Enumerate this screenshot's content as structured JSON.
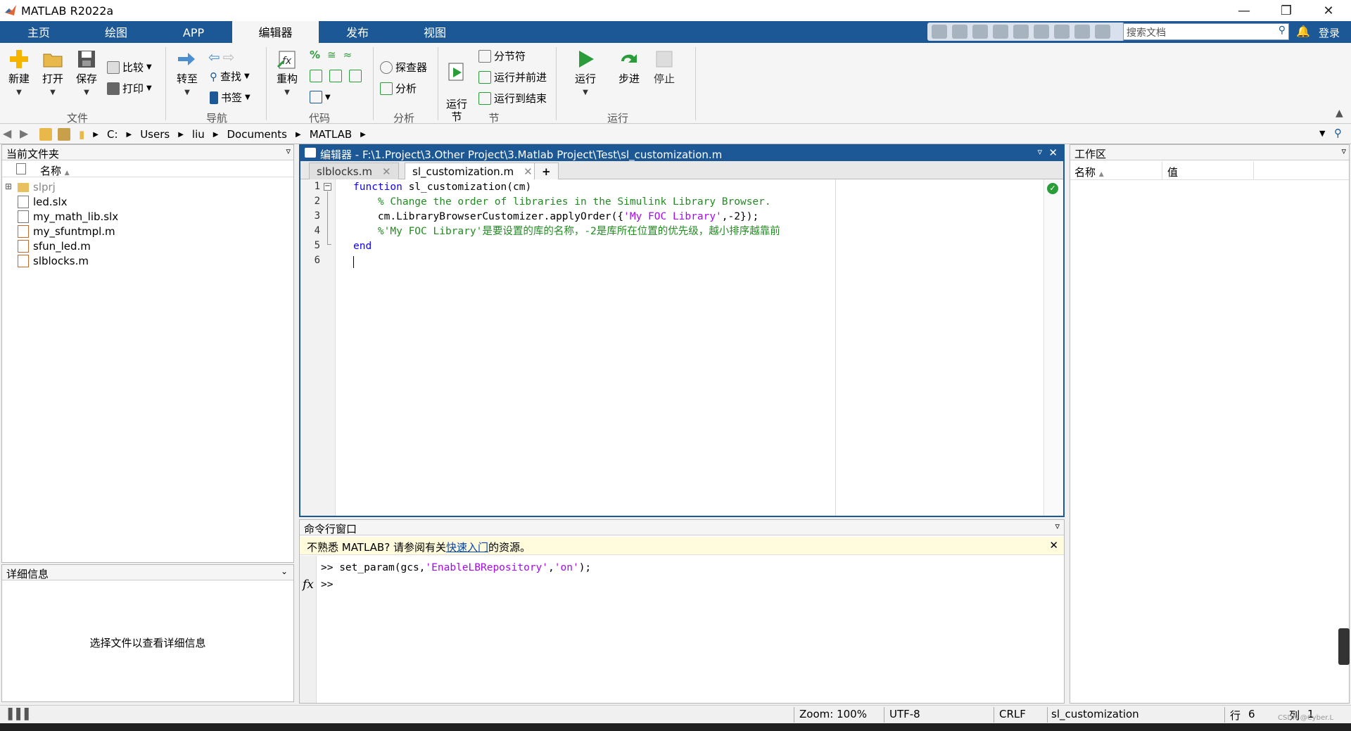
{
  "window": {
    "title": "MATLAB R2022a"
  },
  "tabs": [
    "主页",
    "绘图",
    "APP",
    "编辑器",
    "发布",
    "视图"
  ],
  "active_tab": "编辑器",
  "search": {
    "placeholder": "搜索文档"
  },
  "login": "登录",
  "ribbon": {
    "file": {
      "new": "新建",
      "open": "打开",
      "save": "保存",
      "compare": "比较",
      "print": "打印",
      "group": "文件"
    },
    "nav": {
      "goto": "转至",
      "find": "查找",
      "bookmark": "书签",
      "group": "导航"
    },
    "code": {
      "refactor": "重构",
      "group": "代码"
    },
    "analyze": {
      "explorer": "探查器",
      "analyze": "分析",
      "group": "分析"
    },
    "section": {
      "run_section": "运行\n节",
      "section_break": "分节符",
      "run_advance": "运行并前进",
      "run_to_end": "运行到结束",
      "group": "节"
    },
    "run": {
      "run": "运行",
      "step": "步进",
      "stop": "停止",
      "group": "运行"
    }
  },
  "address": {
    "path": [
      "C:",
      "Users",
      "liu",
      "Documents",
      "MATLAB"
    ]
  },
  "current_folder": {
    "title": "当前文件夹",
    "column": "名称",
    "files": [
      "slprj",
      "led.slx",
      "my_math_lib.slx",
      "my_sfuntmpl.m",
      "sfun_led.m",
      "slblocks.m"
    ]
  },
  "details": {
    "title": "详细信息",
    "message": "选择文件以查看详细信息"
  },
  "editor": {
    "title": "编辑器 - F:\\1.Project\\3.Other Project\\3.Matlab Project\\Test\\sl_customization.m",
    "tabs": [
      "slblocks.m",
      "sl_customization.m"
    ],
    "active_tab": "sl_customization.m",
    "line_numbers": [
      "1",
      "2",
      "3",
      "4",
      "5",
      "6"
    ],
    "lines": {
      "l1_kw": "function",
      "l1_rest": " sl_customization(cm)",
      "l2": "    % Change the order of libraries in the Simulink Library Browser.",
      "l3_a": "    cm.LibraryBrowserCustomizer.applyOrder({",
      "l3_str": "'My FOC Library'",
      "l3_b": ",-2});",
      "l4": "    %'My FOC Library'是要设置的库的名称，-2是库所在位置的优先级，越小排序越靠前",
      "l5_kw": "end"
    }
  },
  "command_window": {
    "title": "命令行窗口",
    "tip_prefix": "不熟悉 MATLAB? 请参阅有关",
    "tip_link": "快速入门",
    "tip_suffix": "的资源。",
    "prompt": ">>",
    "cmd_a": " set_param(gcs,",
    "cmd_str1": "'EnableLBRepository'",
    "cmd_comma": ",",
    "cmd_str2": "'on'",
    "cmd_b": ");",
    "fx": "fx"
  },
  "workspace": {
    "title": "工作区",
    "col_name": "名称",
    "col_value": "值"
  },
  "status": {
    "zoom": "Zoom: 100%",
    "encoding": "UTF-8",
    "eol": "CRLF",
    "file": "sl_customization",
    "row_label": "行",
    "row": "6",
    "col_label": "列",
    "col": "1"
  },
  "watermark": "CSDN @Cyber.L"
}
